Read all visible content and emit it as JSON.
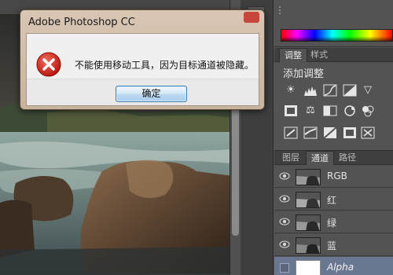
{
  "dialog": {
    "title": "Adobe Photoshop CC",
    "message": "不能使用移动工具，因为目标通道被隐藏。",
    "ok_label": "确定"
  },
  "adjustments_panel": {
    "tabs": [
      "调整",
      "样式"
    ],
    "title": "添加调整",
    "icons": [
      "brightness-contrast-icon",
      "levels-icon",
      "curves-icon",
      "exposure-icon",
      "vibrance-icon",
      "color-balance-icon",
      "black-white-icon",
      "photo-filter-icon",
      "channel-mixer-icon",
      "color-lookup-icon",
      "invert-icon",
      "posterize-icon",
      "threshold-icon",
      "gradient-map-icon",
      "selective-color-icon"
    ]
  },
  "channels_panel": {
    "tabs": [
      "图层",
      "通道",
      "路径"
    ],
    "channels": [
      {
        "name": "RGB",
        "visible": true,
        "selected": false
      },
      {
        "name": "红",
        "visible": true,
        "selected": false
      },
      {
        "name": "绿",
        "visible": true,
        "selected": false
      },
      {
        "name": "蓝",
        "visible": true,
        "selected": false
      },
      {
        "name": "Alpha",
        "visible": false,
        "selected": true
      }
    ]
  },
  "colors": {
    "dialog_frame": "#d9c6b3",
    "ok_button_border": "#3c7fb1",
    "error_red": "#d8312a",
    "selected_row": "#6a7790",
    "panel_bg": "#535353"
  }
}
